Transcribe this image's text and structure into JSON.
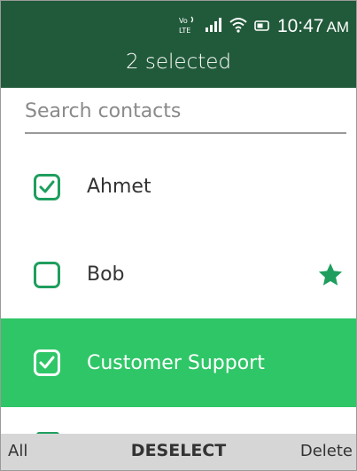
{
  "status": {
    "network_label": "LTE",
    "time": "10:47",
    "ampm": "AM"
  },
  "header": {
    "title": "2 selected"
  },
  "search": {
    "placeholder": "Search contacts",
    "value": ""
  },
  "contacts": [
    {
      "name": "Ahmet",
      "checked": true,
      "favorite": false,
      "highlighted": false
    },
    {
      "name": "Bob",
      "checked": false,
      "favorite": true,
      "highlighted": false
    },
    {
      "name": "Customer Support",
      "checked": true,
      "favorite": false,
      "highlighted": true
    }
  ],
  "softkeys": {
    "left": "All",
    "center": "DESELECT",
    "right": "Delete"
  },
  "colors": {
    "header_bg": "#215a3a",
    "accent_green": "#1f9e5e",
    "highlight_bg": "#2fc667",
    "softkey_bg": "#d6d6d6"
  },
  "icons": {
    "checkbox_checked": "check-icon",
    "checkbox_unchecked": "empty-checkbox-icon",
    "favorite": "star-icon"
  }
}
